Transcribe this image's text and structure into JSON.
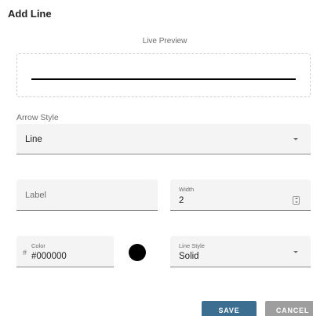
{
  "dialog": {
    "title": "Add Line",
    "preview_label": "Live Preview",
    "arrow_style": {
      "label": "Arrow Style",
      "value": "Line"
    },
    "label_field": {
      "placeholder": "Label",
      "value": ""
    },
    "width_field": {
      "label": "Width",
      "value": "2"
    },
    "color_field": {
      "prefix": "#",
      "label": "Color",
      "value": "#000000"
    },
    "line_style": {
      "label": "Line Style",
      "value": "Solid"
    },
    "buttons": {
      "save": "SAVE",
      "cancel": "CANCEL"
    },
    "colors": {
      "line_color": "#000000",
      "save_button": "#3c6e91",
      "cancel_button": "#9e9e9e"
    }
  }
}
